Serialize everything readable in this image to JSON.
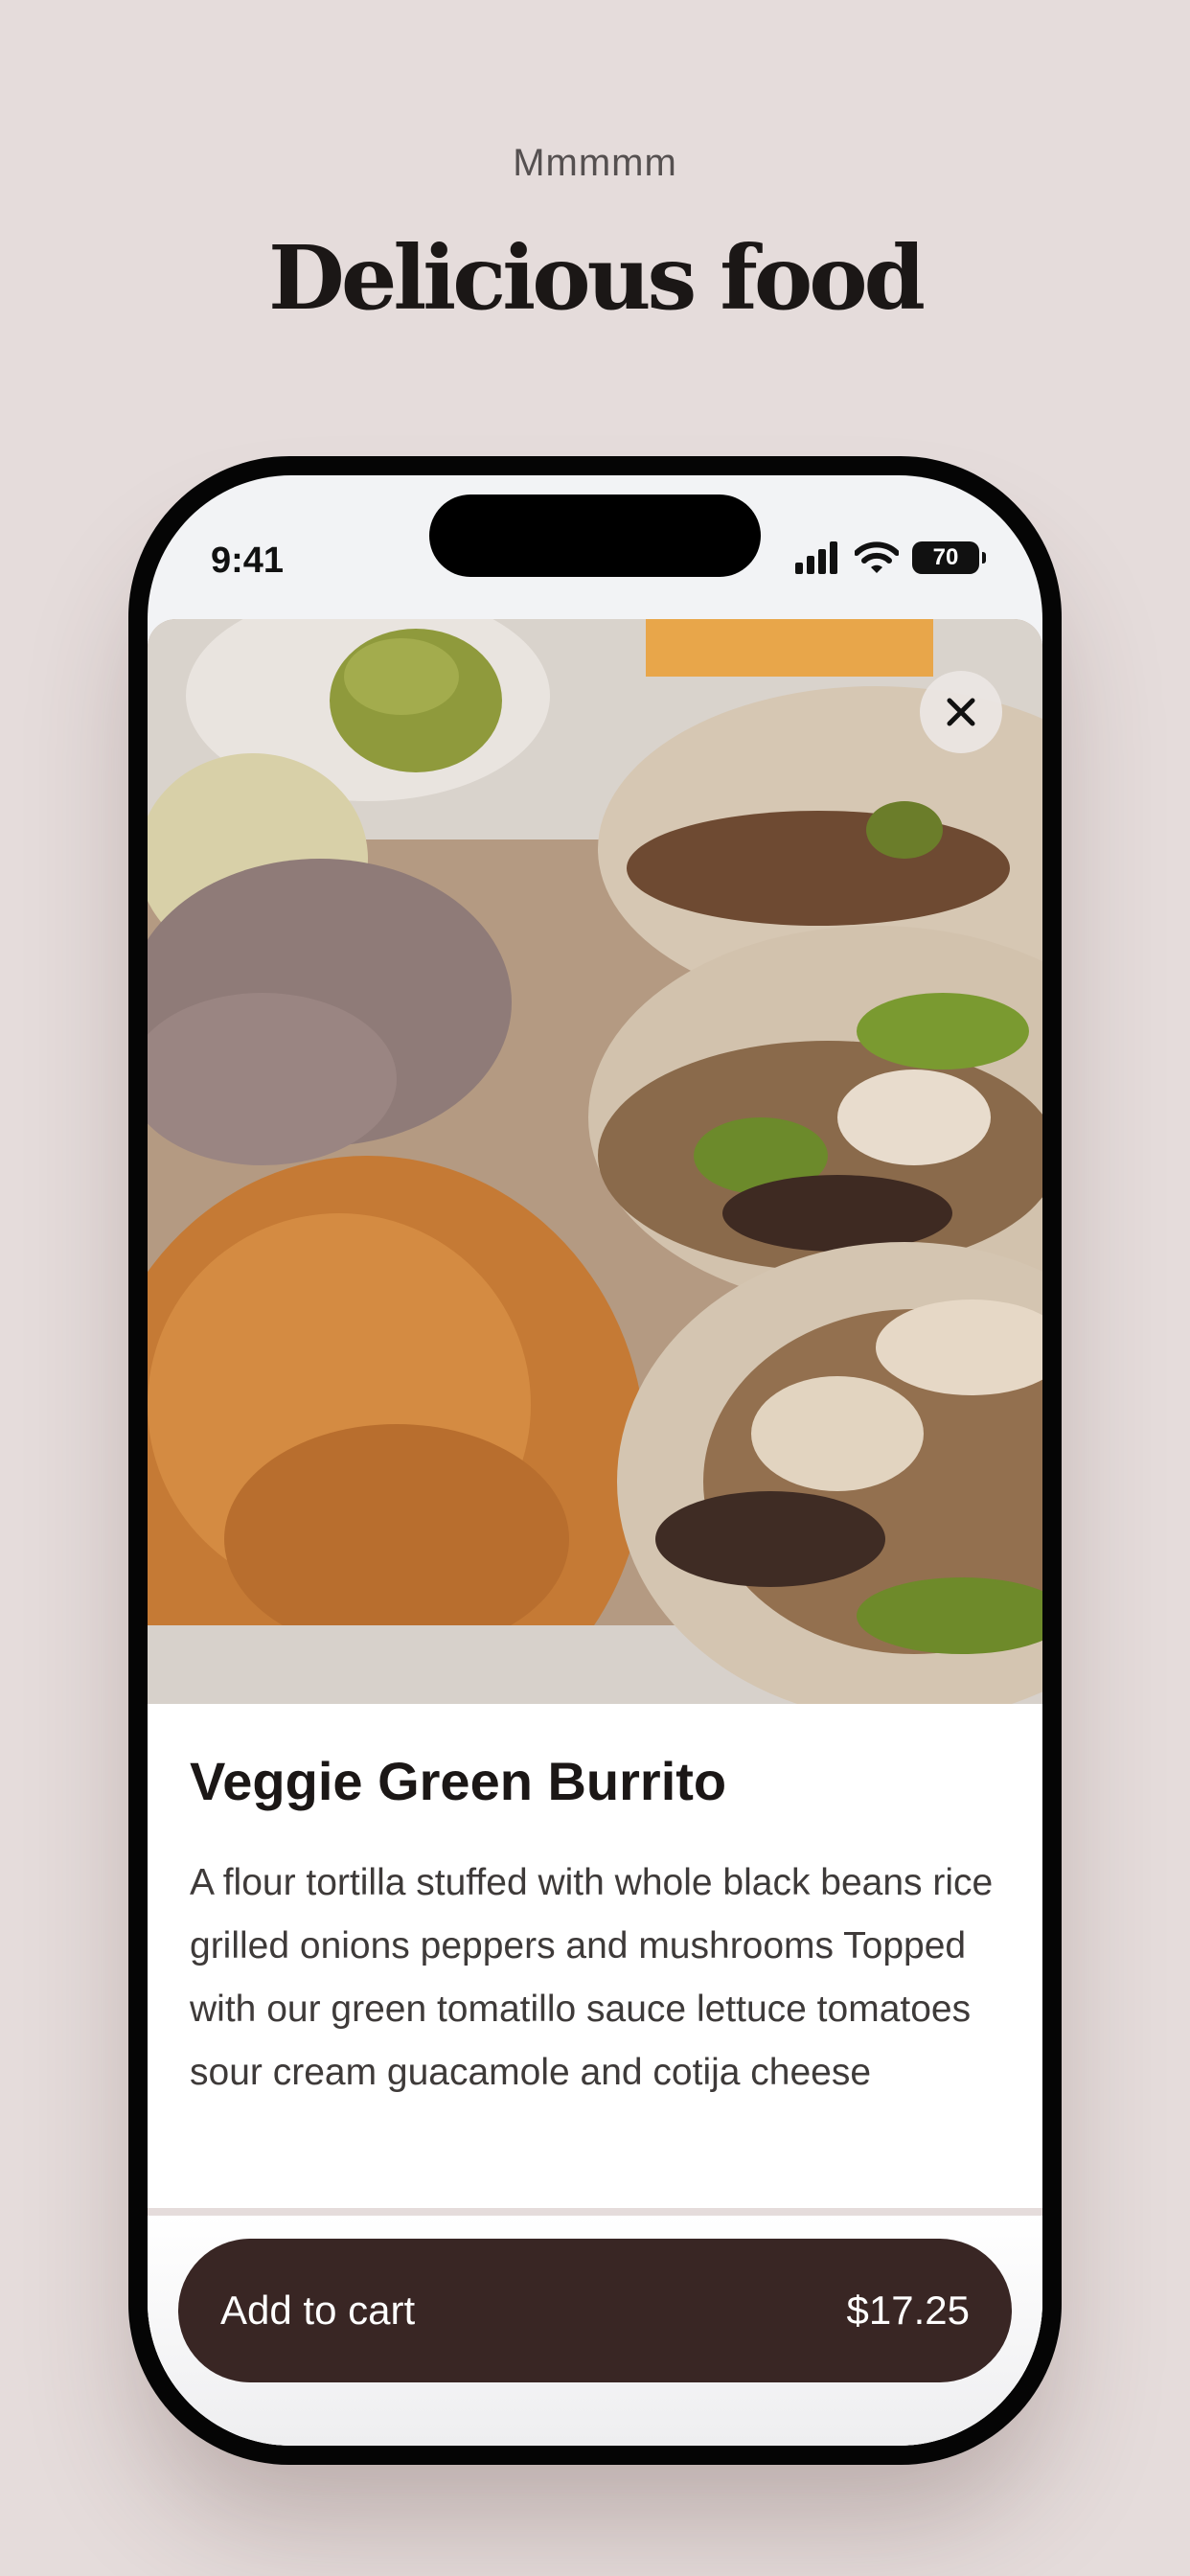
{
  "header": {
    "eyebrow": "Mmmmm",
    "title": "Delicious food"
  },
  "status_bar": {
    "time": "9:41",
    "battery": "70",
    "icons": [
      "signal-icon",
      "wifi-icon",
      "battery-icon"
    ]
  },
  "product": {
    "image": "tacos-photo",
    "name": "Veggie Green Burrito",
    "description": "A flour tortilla stuffed with whole black beans rice grilled onions peppers and mushrooms Topped with our green tomatillo sauce lettuce tomatoes sour cream guacamole and cotija cheese"
  },
  "cart": {
    "label": "Add to cart",
    "price": "$17.25"
  },
  "colors": {
    "background": "#e5dcdb",
    "button": "#392624",
    "text": "#1b1716"
  }
}
